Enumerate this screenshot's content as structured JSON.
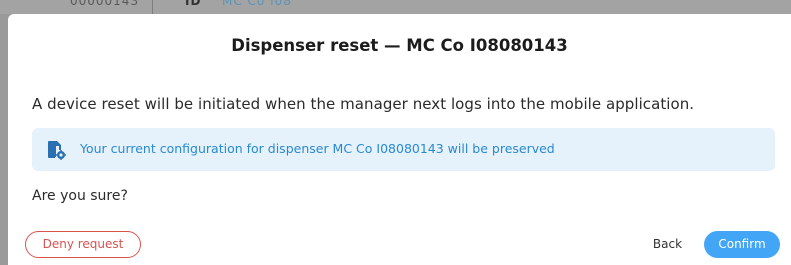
{
  "backdrop": {
    "text_a": "00000143",
    "text_b": "ID",
    "text_c": "MC Co I08"
  },
  "dialog": {
    "title": "Dispenser reset — MC Co I08080143",
    "message": "A device reset will be initiated when the manager next logs into the mobile application.",
    "info": {
      "icon": "file-settings-icon",
      "text": "Your current configuration for dispenser MC Co I08080143 will be preserved",
      "color": "#2a8ad0",
      "background": "#e5f1fb"
    },
    "question": "Are you sure?",
    "buttons": {
      "deny_label": "Deny request",
      "back_label": "Back",
      "confirm_label": "Confirm"
    },
    "colors": {
      "deny": "#d9534f",
      "confirm": "#42a5f5"
    }
  }
}
